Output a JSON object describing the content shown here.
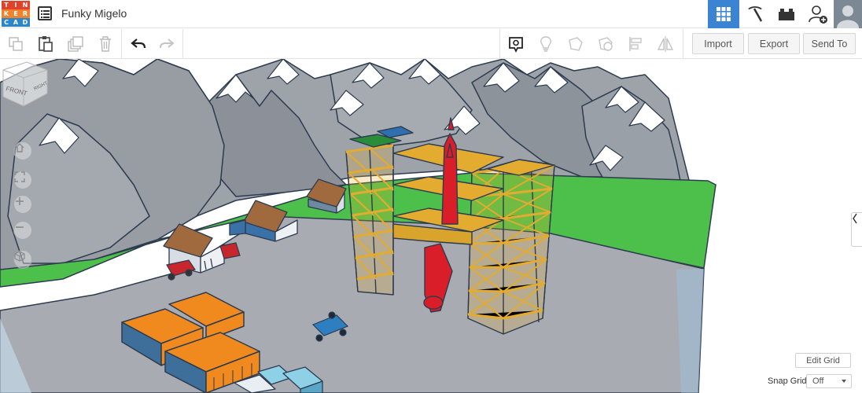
{
  "app": {
    "logo": [
      "T",
      "I",
      "N",
      "K",
      "E",
      "R",
      "C",
      "A",
      "D"
    ],
    "logo_colors": [
      "#e2412b",
      "#e2412b",
      "#e2412b",
      "#f0822e",
      "#f0822e",
      "#f0822e",
      "#2c86c9",
      "#2c86c9",
      "#2c86c9"
    ],
    "design_title": "Funky Migelo"
  },
  "header_icons": [
    "grid-view-icon",
    "pickaxe-icon",
    "brick-icon",
    "add-user-icon",
    "user-avatar"
  ],
  "toolbar": {
    "actions": [
      "copy-icon",
      "paste-icon",
      "duplicate-icon",
      "delete-icon",
      "undo-icon",
      "redo-icon"
    ],
    "view_tools": [
      "notes-icon",
      "light-bulb-icon",
      "shape-icon",
      "hole-icon",
      "align-icon",
      "mirror-icon"
    ],
    "import_label": "Import",
    "export_label": "Export",
    "send_label": "Send To"
  },
  "viewcube": {
    "front_label": "FRONT",
    "right_label": "RIGHT"
  },
  "nav_controls": [
    "home-icon",
    "fit-icon",
    "zoom-in-icon",
    "zoom-out-icon",
    "perspective-icon"
  ],
  "grid": {
    "edit_label": "Edit Grid",
    "snap_label": "Snap Grid",
    "snap_value": "Off"
  },
  "colors": {
    "accent": "#3b84d3",
    "ground": "#4cc04a",
    "plaza": "#a8acb2",
    "scaffold": "#e3ab2f",
    "rocket": "#d91e2a",
    "container": "#f08a1e"
  }
}
